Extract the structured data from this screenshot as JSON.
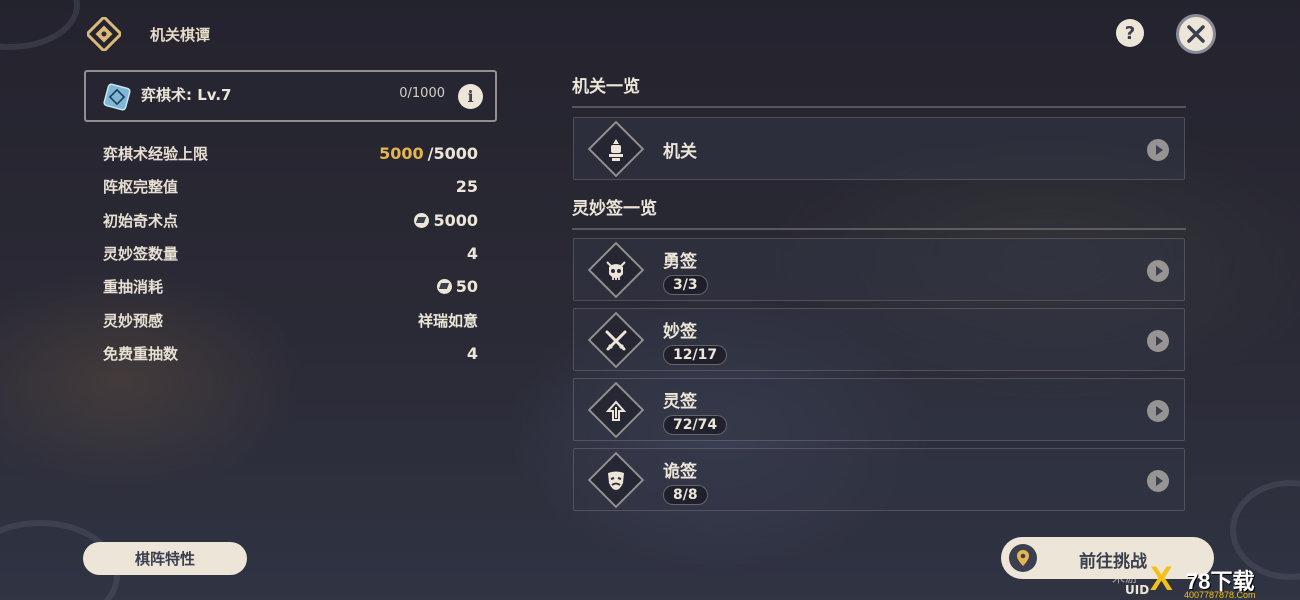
{
  "header": {
    "title": "机关棋谭",
    "help_icon": "question-icon",
    "close_icon": "close-icon"
  },
  "level_card": {
    "label": "弈棋术: Lv.7",
    "exp": "0/1000",
    "info_glyph": "i"
  },
  "stats": [
    {
      "label": "弈棋术经验上限",
      "value_highlight": "5000",
      "value": "/5000"
    },
    {
      "label": "阵枢完整值",
      "value": "25"
    },
    {
      "label": "初始奇术点",
      "value": "5000",
      "icon": "coin-icon"
    },
    {
      "label": "灵妙签数量",
      "value": "4"
    },
    {
      "label": "重抽消耗",
      "value": "50",
      "icon": "coin-icon"
    },
    {
      "label": "灵妙预感",
      "value": "祥瑞如意"
    },
    {
      "label": "免费重抽数",
      "value": "4"
    }
  ],
  "formation_button": "棋阵特性",
  "mechanisms_section": {
    "title": "机关一览",
    "items": [
      {
        "label": "机关",
        "icon": "turret-icon"
      }
    ]
  },
  "cards_section": {
    "title": "灵妙签一览",
    "items": [
      {
        "label": "勇签",
        "count": "3/3",
        "icon": "skull-icon"
      },
      {
        "label": "妙签",
        "count": "12/17",
        "icon": "crossed-swords-icon"
      },
      {
        "label": "灵签",
        "count": "72/74",
        "icon": "arrow-up-icon"
      },
      {
        "label": "诡签",
        "count": "8/8",
        "icon": "mask-icon"
      }
    ]
  },
  "go_button": "前往挑战",
  "uid_label": "UID",
  "watermark": {
    "faint": "米游",
    "x": "X",
    "main": "78下载",
    "url": "4007787878.Com"
  },
  "colors": {
    "accent_gold": "#e6b54f",
    "button_bg": "#ece5d8",
    "button_text": "#3b3f4e",
    "watermark_yellow": "#f3c01a"
  }
}
